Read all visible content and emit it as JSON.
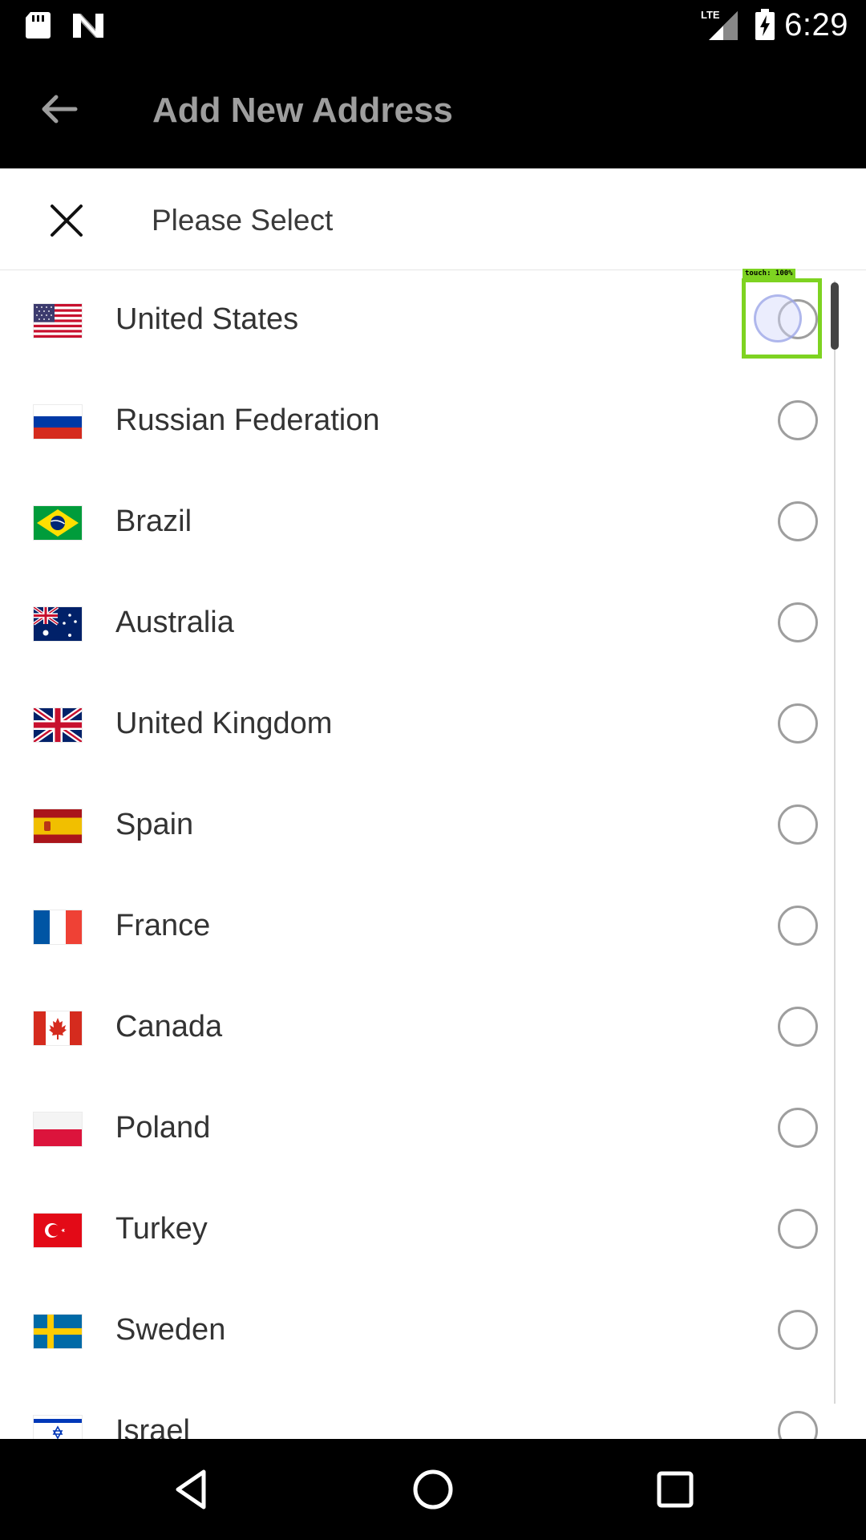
{
  "status_bar": {
    "time": "6:29",
    "network": "LTE",
    "icons": [
      "sd-card-icon",
      "n-icon",
      "lte-signal-icon",
      "battery-charging-icon"
    ]
  },
  "app_bar": {
    "title": "Add New Address",
    "back_icon": "arrow-back-icon"
  },
  "sheet": {
    "title": "Please Select",
    "close_icon": "close-icon"
  },
  "countries": [
    {
      "name": "United States",
      "flag": "us",
      "selected": false
    },
    {
      "name": "Russian Federation",
      "flag": "ru",
      "selected": false
    },
    {
      "name": "Brazil",
      "flag": "br",
      "selected": false
    },
    {
      "name": "Australia",
      "flag": "au",
      "selected": false
    },
    {
      "name": "United Kingdom",
      "flag": "gb",
      "selected": false
    },
    {
      "name": "Spain",
      "flag": "es",
      "selected": false
    },
    {
      "name": "France",
      "flag": "fr",
      "selected": false
    },
    {
      "name": "Canada",
      "flag": "ca",
      "selected": false
    },
    {
      "name": "Poland",
      "flag": "pl",
      "selected": false
    },
    {
      "name": "Turkey",
      "flag": "tr",
      "selected": false
    },
    {
      "name": "Sweden",
      "flag": "se",
      "selected": false
    },
    {
      "name": "Israel",
      "flag": "il",
      "selected": false
    }
  ],
  "touch_overlay": {
    "label": "touch: 100%",
    "color": "#7ed321"
  },
  "nav_bar": {
    "icons": [
      "nav-back-icon",
      "nav-home-icon",
      "nav-recents-icon"
    ]
  },
  "colors": {
    "bars": "#000000",
    "title_text": "#9e9e9e",
    "list_text": "#333333",
    "radio_border": "#9e9e9e"
  }
}
